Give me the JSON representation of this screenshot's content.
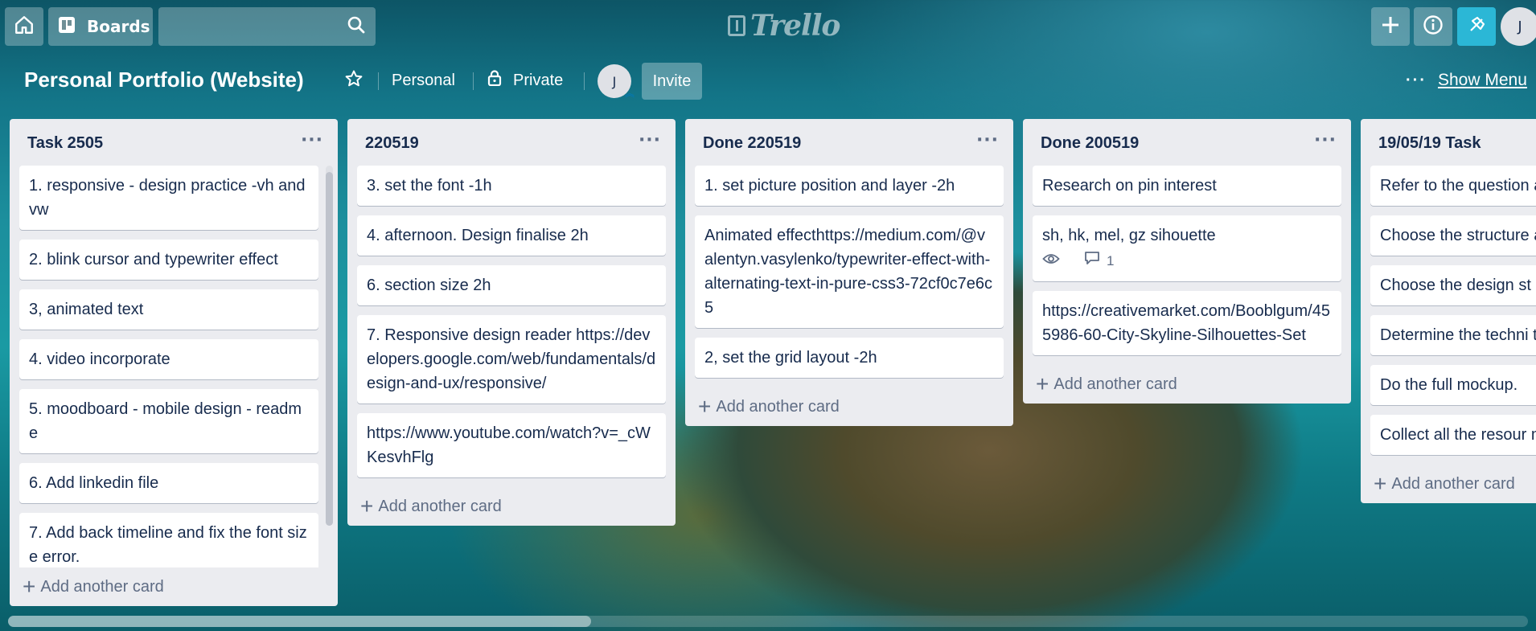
{
  "header": {
    "boards_label": "Boards",
    "logo_text": "Trello",
    "avatar_initial": "J",
    "search_value": ""
  },
  "board": {
    "title": "Personal Portfolio (Website)",
    "team_label": "Personal",
    "visibility_label": "Private",
    "member_initial": "J",
    "invite_label": "Invite",
    "show_menu_label": "Show Menu",
    "show_menu_dots": "···"
  },
  "add_card_label": "Add another card",
  "list_menu_glyph": "···",
  "lists": [
    {
      "title": "Task 2505",
      "cards": [
        {
          "text": "1. responsive - design practice -vh and vw"
        },
        {
          "text": "2. blink cursor and typewriter effect"
        },
        {
          "text": "3, animated text"
        },
        {
          "text": "4. video incorporate"
        },
        {
          "text": "5. moodboard - mobile design - readme"
        },
        {
          "text": "6. Add linkedin file"
        },
        {
          "text": "7. Add back timeline and fix the font size error."
        }
      ]
    },
    {
      "title": "220519",
      "cards": [
        {
          "text": "3. set the font -1h"
        },
        {
          "text": "4. afternoon. Design finalise 2h"
        },
        {
          "text": "6. section size 2h"
        },
        {
          "text": "7. Responsive design reader https://developers.google.com/web/fundamentals/design-and-ux/responsive/"
        },
        {
          "text": "https://www.youtube.com/watch?v=_cWKesvhFlg"
        }
      ]
    },
    {
      "title": "Done 220519",
      "cards": [
        {
          "text": "1. set picture position and layer -2h"
        },
        {
          "text": "Animated effecthttps://medium.com/@valentyn.vasylenko/typewriter-effect-with-alternating-text-in-pure-css3-72cf0c7e6c5"
        },
        {
          "text": "2, set the grid layout -2h"
        }
      ]
    },
    {
      "title": "Done 200519",
      "cards": [
        {
          "text": "Research on pin interest"
        },
        {
          "text": "sh, hk, mel, gz sihouette",
          "comments": "1",
          "watched": true
        },
        {
          "text": "https://creativemarket.com/Booblgum/455986-60-City-Skyline-Silhouettes-Set"
        }
      ]
    },
    {
      "title": "19/05/19 Task",
      "cards": [
        {
          "text": "Refer to the question and design:"
        },
        {
          "text": "Choose the structure argument."
        },
        {
          "text": "Choose the design st"
        },
        {
          "text": "Determine the techni test it."
        },
        {
          "text": "Do the full mockup."
        },
        {
          "text": "Collect all the resour mockup"
        }
      ]
    }
  ],
  "icons": {
    "home": "home-icon",
    "boards": "boards-icon",
    "search": "search-icon",
    "plus": "plus-icon",
    "info": "info-icon",
    "notifications": "notification-icon",
    "star": "star-icon",
    "lock": "lock-icon",
    "watch": "eye-icon",
    "comment": "comment-icon"
  },
  "colors": {
    "list_bg": "#ebecf0",
    "card_bg": "#ffffff",
    "text": "#172b4d",
    "muted": "#5e6c84",
    "notification_btn": "#2bb7d6"
  }
}
